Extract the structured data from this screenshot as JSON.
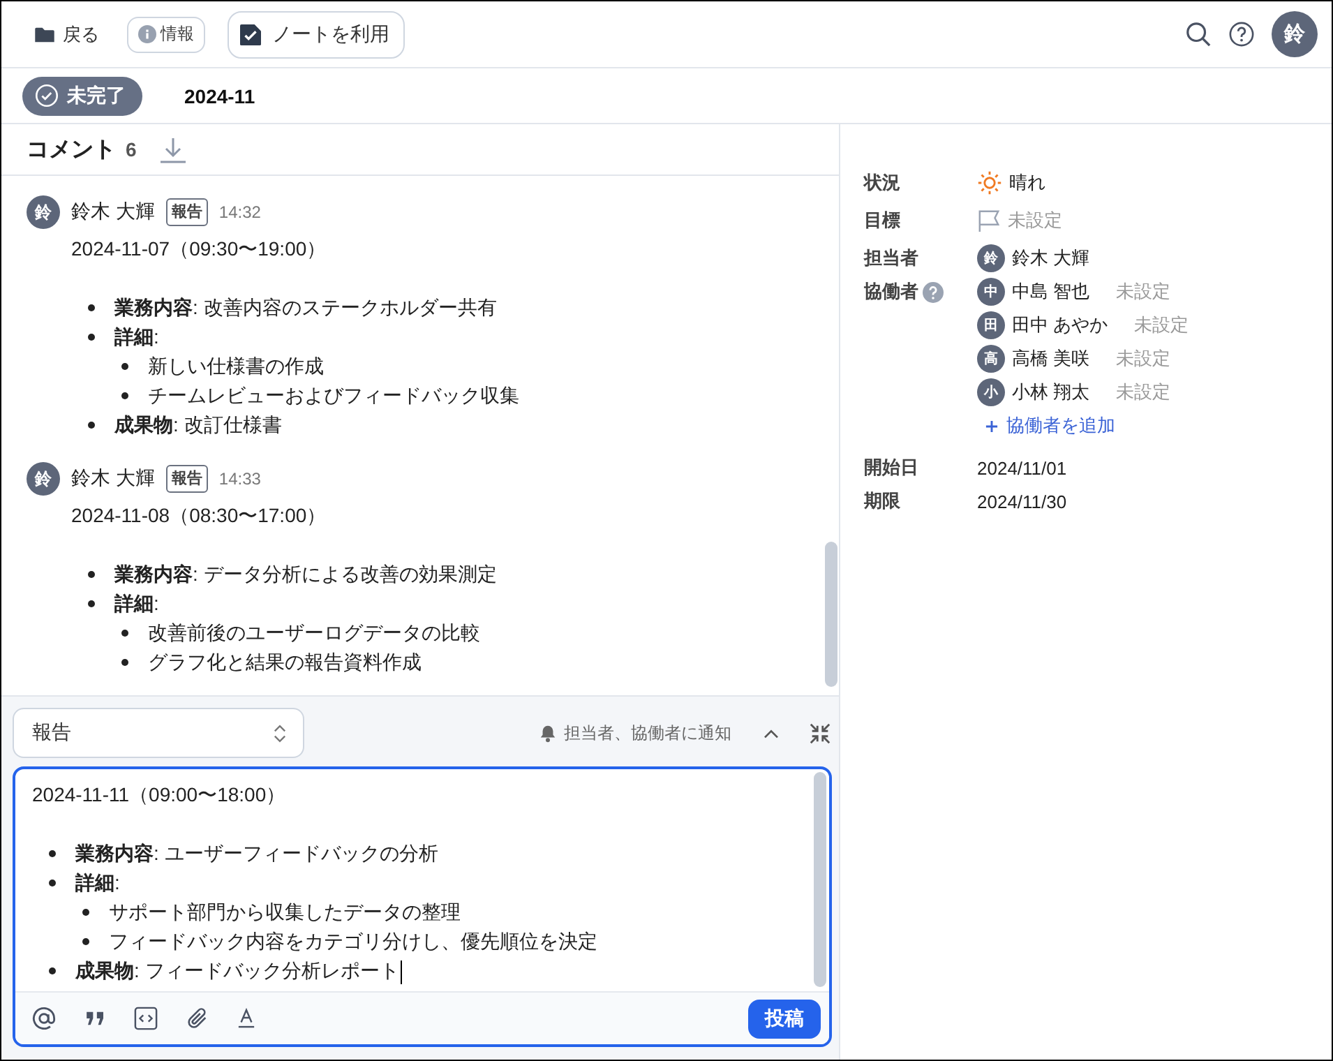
{
  "toolbar": {
    "back": "戻る",
    "info": "情報",
    "note": {
      "label": "ノートを利用",
      "checked": true
    },
    "avatar": "鈴"
  },
  "status": {
    "badge": "未完了",
    "done": false,
    "period": "2024-11"
  },
  "comments": {
    "title": "コメント",
    "count": "6",
    "items": [
      {
        "avatar": "鈴",
        "author": "鈴木 大輝",
        "tag": "報告",
        "time": "14:32",
        "date_line": "2024-11-07（09:30〜19:00）",
        "bullets": [
          {
            "text": "**業務内容**: 改善内容のステークホルダー共有"
          },
          {
            "text": "**詳細**:",
            "children": [
              {
                "text": "新しい仕様書の作成"
              },
              {
                "text": "チームレビューおよびフィードバック収集"
              }
            ]
          },
          {
            "text": "**成果物**: 改訂仕様書"
          }
        ]
      },
      {
        "avatar": "鈴",
        "author": "鈴木 大輝",
        "tag": "報告",
        "time": "14:33",
        "date_line": "2024-11-08（08:30〜17:00）",
        "bullets": [
          {
            "text": "**業務内容**: データ分析による改善の効果測定"
          },
          {
            "text": "**詳細**:",
            "children": [
              {
                "text": "改善前後のユーザーログデータの比較"
              },
              {
                "text": "グラフ化と結果の報告資料作成"
              }
            ]
          }
        ]
      }
    ]
  },
  "composer": {
    "type": "報告",
    "notify": "担当者、協働者に通知",
    "date_line": "2024-11-11（09:00〜18:00）",
    "bullets": [
      {
        "text": "**業務内容**: ユーザーフィードバックの分析"
      },
      {
        "text": "**詳細**:",
        "children": [
          {
            "text": "サポート部門から収集したデータの整理"
          },
          {
            "text": "フィードバック内容をカテゴリ分けし、優先順位を決定"
          }
        ]
      },
      {
        "text": "**成果物**: フィードバック分析レポート"
      }
    ],
    "submit": "投稿"
  },
  "details": {
    "status": {
      "label": "状況",
      "value": "晴れ"
    },
    "goal": {
      "label": "目標",
      "value": "未設定"
    },
    "assignee": {
      "label": "担当者",
      "avatar": "鈴",
      "name": "鈴木 大輝"
    },
    "collaborators": {
      "label": "協働者",
      "items": [
        {
          "avatar": "中",
          "name": "中島 智也",
          "role": "未設定"
        },
        {
          "avatar": "田",
          "name": "田中 あやか",
          "role": "未設定"
        },
        {
          "avatar": "高",
          "name": "高橋 美咲",
          "role": "未設定"
        },
        {
          "avatar": "小",
          "name": "小林 翔太",
          "role": "未設定"
        }
      ],
      "add": "協働者を追加"
    },
    "start": {
      "label": "開始日",
      "value": "2024/11/01"
    },
    "due": {
      "label": "期限",
      "value": "2024/11/30"
    }
  }
}
